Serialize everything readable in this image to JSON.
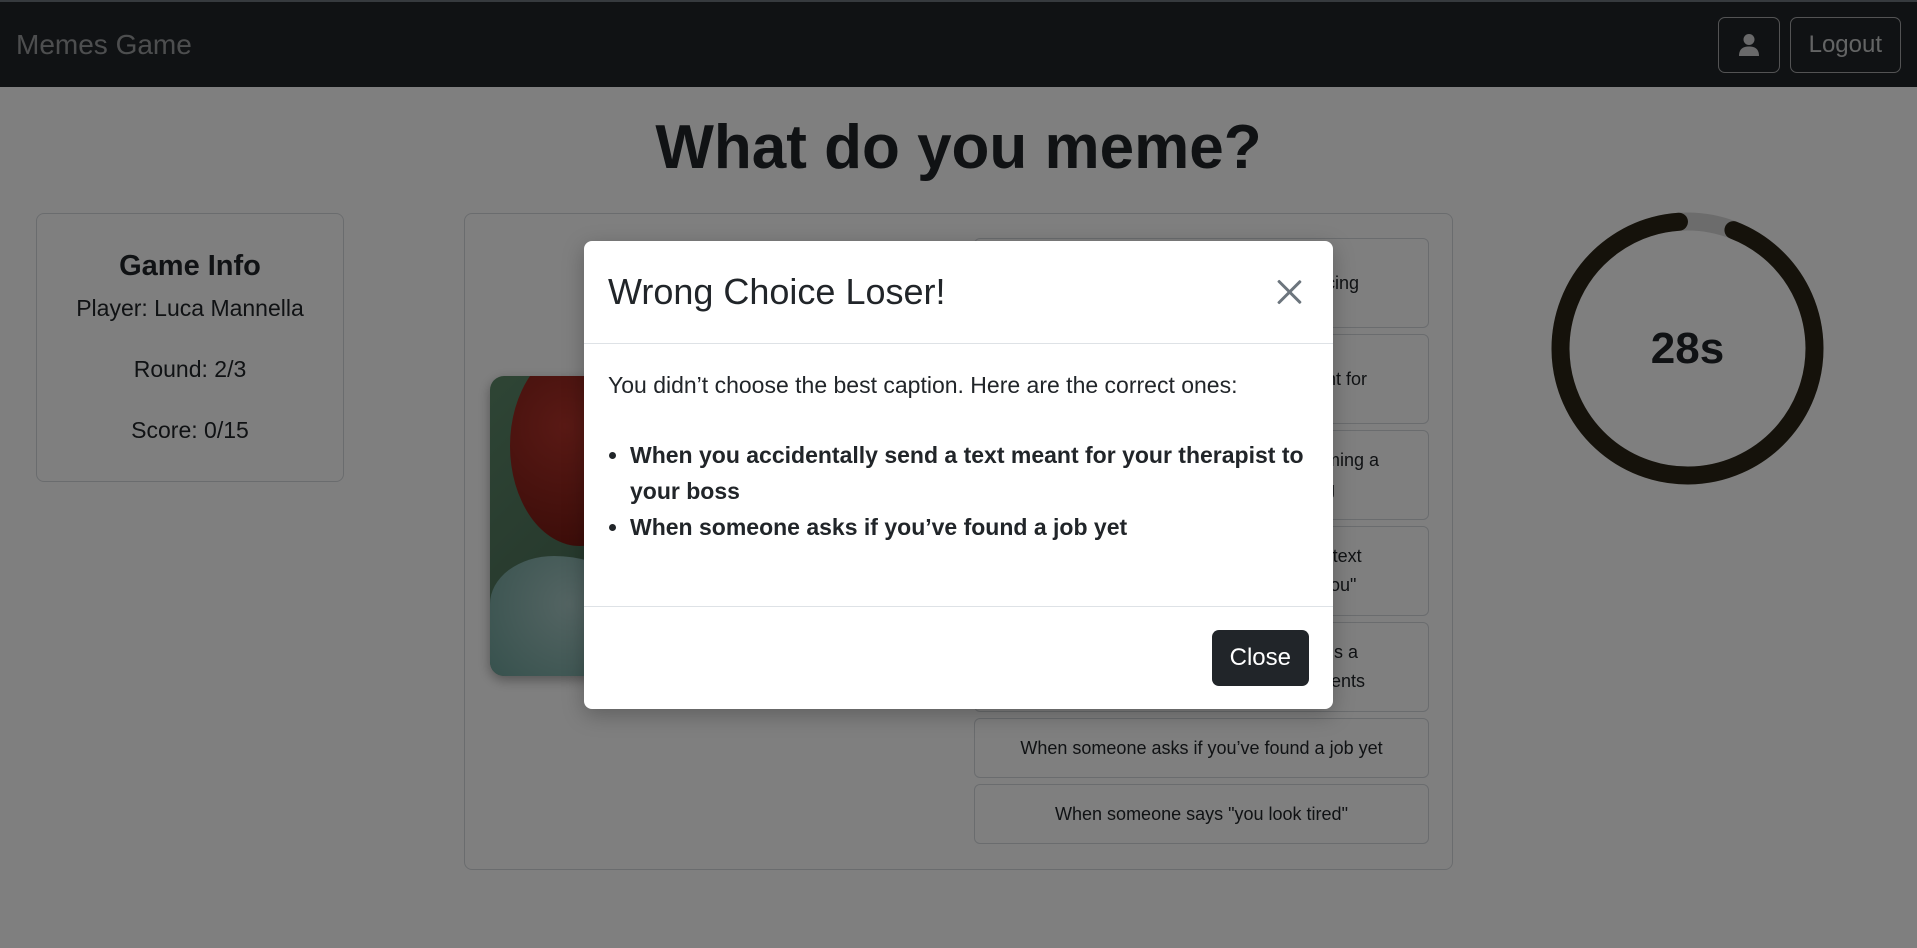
{
  "navbar": {
    "brand": "Memes Game",
    "logout_label": "Logout"
  },
  "page": {
    "title": "What do you meme?"
  },
  "game_info": {
    "title": "Game Info",
    "player": "Player: Luca Mannella",
    "round": "Round: 2/3",
    "score": "Score: 0/15"
  },
  "captions": [
    {
      "text": "uncing"
    },
    {
      "text": "eant for"
    },
    {
      "text": "coming a\nting"
    },
    {
      "text": "x’s text\ne you\""
    },
    {
      "text": "ife is a\noments"
    },
    {
      "text": "When someone asks if you’ve found a job yet"
    },
    {
      "text": "When someone says \"you look tired\""
    }
  ],
  "timer": {
    "label": "28s",
    "fraction_remaining": 0.93,
    "color": "#2b2516"
  },
  "modal": {
    "title": "Wrong Choice Loser!",
    "message": "You didn’t choose the best caption. Here are the correct ones:",
    "correct_captions": [
      "When you accidentally send a text meant for your therapist to your boss",
      "When someone asks if you’ve found a job yet"
    ],
    "close_label": "Close"
  }
}
